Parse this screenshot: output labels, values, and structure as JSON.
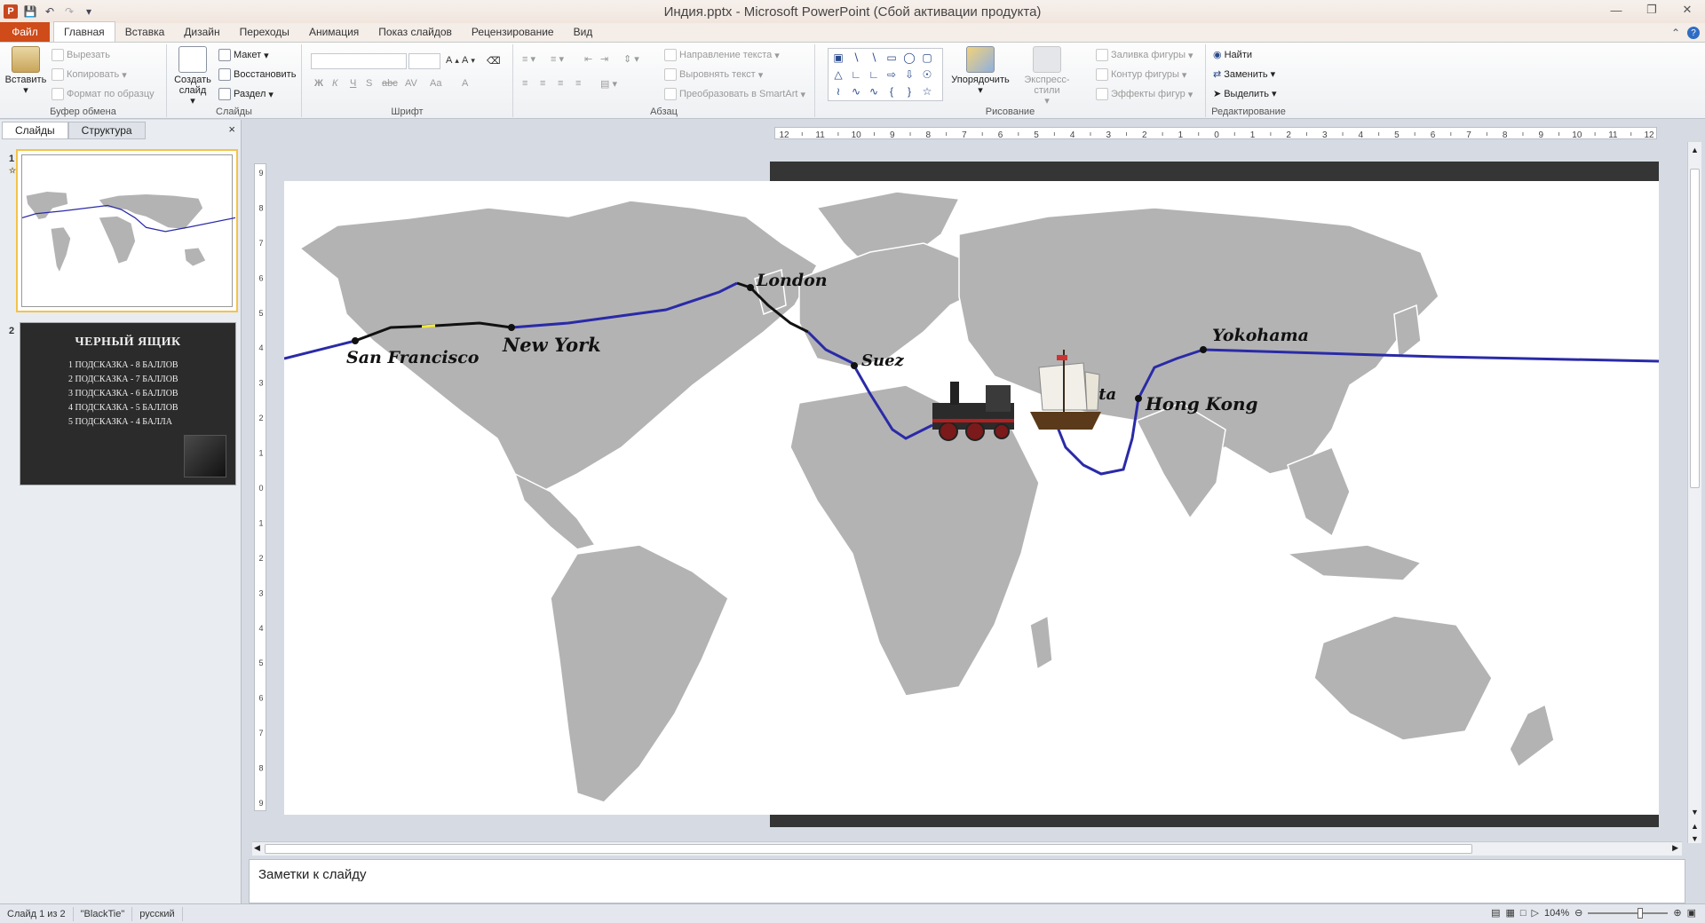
{
  "window": {
    "title": "Индия.pptx - Microsoft PowerPoint (Сбой активации продукта)"
  },
  "ribbon_tabs": [
    "Файл",
    "Главная",
    "Вставка",
    "Дизайн",
    "Переходы",
    "Анимация",
    "Показ слайдов",
    "Рецензирование",
    "Вид"
  ],
  "clipboard": {
    "paste": "Вставить",
    "cut": "Вырезать",
    "copy": "Копировать",
    "format_painter": "Формат по образцу",
    "label": "Буфер обмена"
  },
  "slides_group": {
    "new_slide": "Создать слайд",
    "layout": "Макет",
    "reset": "Восстановить",
    "section": "Раздел",
    "label": "Слайды"
  },
  "font_group": {
    "label": "Шрифт",
    "bold": "Ж",
    "italic": "К",
    "underline": "Ч",
    "strike": "abc",
    "shadow": "S",
    "spacing": "AV",
    "case": "Aa",
    "grow": "A",
    "shrink": "A",
    "color": "A"
  },
  "paragraph_group": {
    "label": "Абзац",
    "text_direction": "Направление текста",
    "align_text": "Выровнять текст",
    "smartart": "Преобразовать в SmartArt"
  },
  "drawing_group": {
    "label": "Рисование",
    "arrange": "Упорядочить",
    "quick_styles": "Экспресс-стили",
    "fill": "Заливка фигуры",
    "outline": "Контур фигуры",
    "effects": "Эффекты фигур"
  },
  "editing_group": {
    "label": "Редактирование",
    "find": "Найти",
    "replace": "Заменить",
    "select": "Выделить"
  },
  "slide_panel": {
    "tab_slides": "Слайды",
    "tab_outline": "Структура",
    "close": "×",
    "slide1_num": "1",
    "slide2_num": "2"
  },
  "slide2": {
    "title": "ЧЕРНЫЙ ЯЩИК",
    "hints": [
      "1 ПОДСКАЗКА - 8 БАЛЛОВ",
      "2 ПОДСКАЗКА - 7 БАЛЛОВ",
      "3 ПОДСКАЗКА - 6 БАЛЛОВ",
      "4 ПОДСКАЗКА - 5 БАЛЛОВ",
      "5 ПОДСКАЗКА - 4 БАЛЛА"
    ]
  },
  "map": {
    "cities": [
      "San Francisco",
      "New York",
      "London",
      "Suez",
      "Calcutta",
      "Hong Kong",
      "Yokohama"
    ],
    "route_color": "#2a2aa8",
    "rail_color": "#111111",
    "land_color": "#b3b3b3"
  },
  "hruler_ticks": [
    "12",
    "11",
    "10",
    "9",
    "8",
    "7",
    "6",
    "5",
    "4",
    "3",
    "2",
    "1",
    "0",
    "1",
    "2",
    "3",
    "4",
    "5",
    "6",
    "7",
    "8",
    "9",
    "10",
    "11",
    "12"
  ],
  "vruler_ticks": [
    "9",
    "8",
    "7",
    "6",
    "5",
    "4",
    "3",
    "2",
    "1",
    "0",
    "1",
    "2",
    "3",
    "4",
    "5",
    "6",
    "7",
    "8",
    "9"
  ],
  "notes": {
    "placeholder": "Заметки к слайду"
  },
  "status": {
    "slide": "Слайд 1 из 2",
    "theme": "\"BlackTie\"",
    "lang": "русский",
    "zoom": "104%"
  }
}
